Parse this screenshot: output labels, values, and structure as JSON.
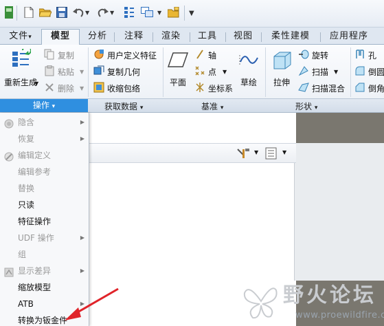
{
  "tabs": [
    {
      "label": "文件",
      "has_arrow": true
    },
    {
      "label": "模型",
      "active": true
    },
    {
      "label": "分析"
    },
    {
      "label": "注释"
    },
    {
      "label": "渲染"
    },
    {
      "label": "工具"
    },
    {
      "label": "视图"
    },
    {
      "label": "柔性建模"
    },
    {
      "label": "应用程序"
    }
  ],
  "tab_file_arrow": "▾",
  "ribbon": {
    "regenerate": "重新生成",
    "copy": "复制",
    "paste": "粘贴",
    "delete": "删除",
    "user_defined_feature": "用户定义特征",
    "copy_geometry": "复制几何",
    "shrinkwrap": "收缩包络",
    "plane": "平面",
    "axis": "轴",
    "point": "点",
    "coordinate_system": "坐标系",
    "sketch": "草绘",
    "extrude": "拉伸",
    "revolve": "旋转",
    "sweep": "扫描",
    "swept_blend": "扫描混合",
    "hole": "孔",
    "round": "倒圆",
    "chamfer": "倒角"
  },
  "groups": {
    "operations": "操作",
    "get_data": "获取数据",
    "datum": "基准",
    "shapes": "形状",
    "arrow": "▾"
  },
  "menu": [
    {
      "label": "隐含",
      "disabled": true,
      "submenu": true,
      "icon": "suppress-icon"
    },
    {
      "label": "恢复",
      "disabled": true,
      "submenu": true
    },
    {
      "label": "编辑定义",
      "disabled": true,
      "icon": "edit-definition-icon"
    },
    {
      "label": "编辑参考",
      "disabled": true
    },
    {
      "label": "替换",
      "disabled": true
    },
    {
      "label": "只读",
      "disabled": false
    },
    {
      "label": "特征操作",
      "disabled": false
    },
    {
      "label": "UDF 操作",
      "disabled": true,
      "submenu": true
    },
    {
      "label": "组",
      "disabled": true
    },
    {
      "label": "显示差异",
      "disabled": true,
      "submenu": true,
      "icon": "show-difference-icon"
    },
    {
      "label": "缩放模型",
      "disabled": false
    },
    {
      "label": "ATB",
      "disabled": false,
      "submenu": true
    },
    {
      "label": "转换为钣金件",
      "disabled": false
    }
  ],
  "submenu_arrow": "▶",
  "watermark": {
    "name": "野火论坛",
    "site": "www.proewildfire.cn"
  },
  "colors": {
    "accent": "#2f8fe0",
    "workspace_gray": "#7a776f",
    "annotation_arrow": "#e0242a"
  }
}
